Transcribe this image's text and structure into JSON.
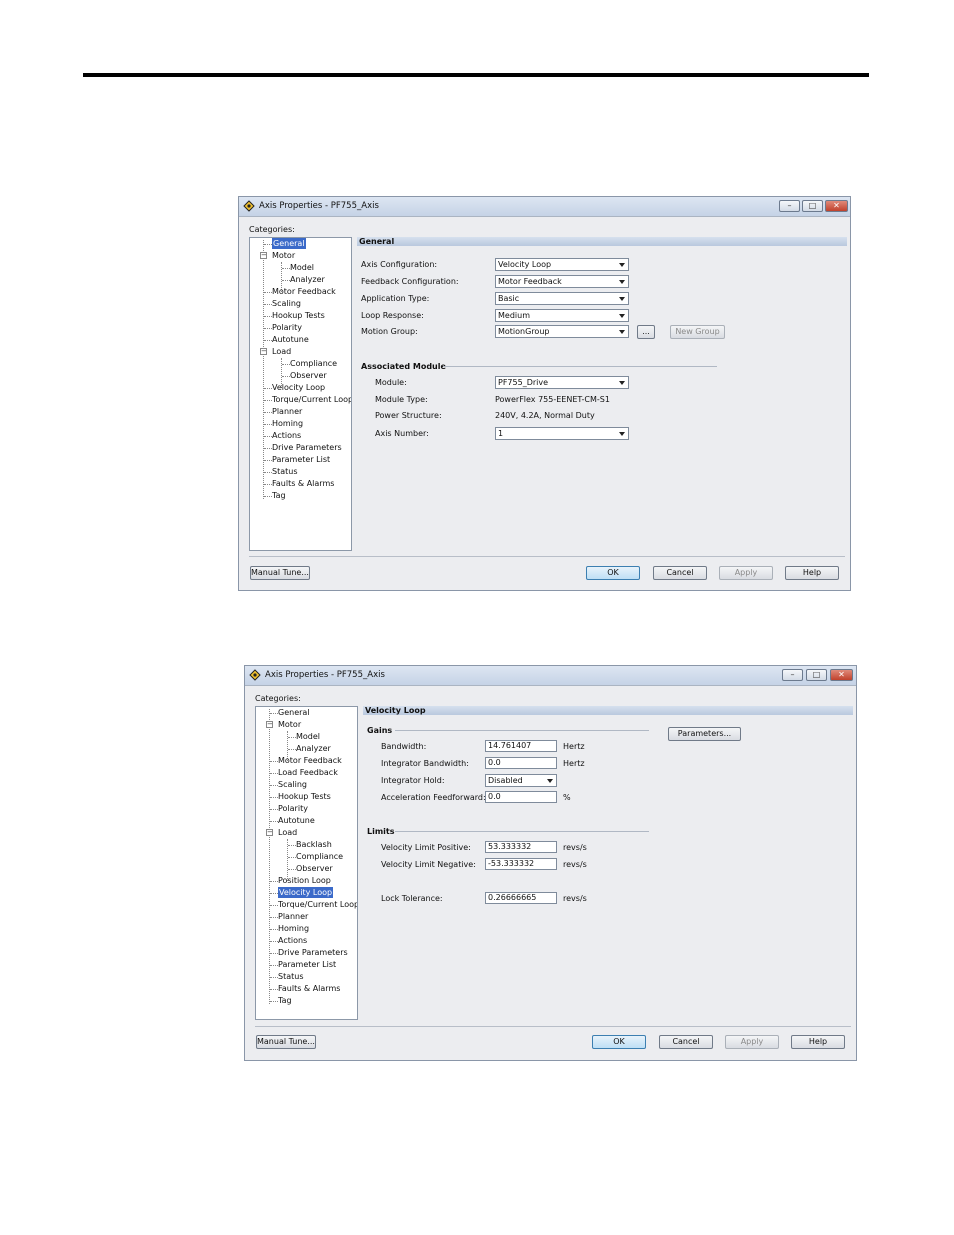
{
  "dialog1": {
    "title": "Axis Properties - PF755_Axis",
    "categories_label": "Categories:",
    "tree": [
      "General",
      "Motor",
      "Model",
      "Analyzer",
      "Motor Feedback",
      "Scaling",
      "Hookup Tests",
      "Polarity",
      "Autotune",
      "Load",
      "Compliance",
      "Observer",
      "Velocity Loop",
      "Torque/Current Loop",
      "Planner",
      "Homing",
      "Actions",
      "Drive Parameters",
      "Parameter List",
      "Status",
      "Faults & Alarms",
      "Tag"
    ],
    "selected": "General",
    "section_title": "General",
    "fields": [
      {
        "label": "Axis Configuration:",
        "value": "Velocity Loop"
      },
      {
        "label": "Feedback Configuration:",
        "value": "Motor Feedback"
      },
      {
        "label": "Application Type:",
        "value": "Basic"
      },
      {
        "label": "Loop Response:",
        "value": "Medium"
      },
      {
        "label": "Motion Group:",
        "value": "MotionGroup"
      }
    ],
    "ellipsis_button": "...",
    "new_group_button": "New Group",
    "associated_module": {
      "title": "Associated Module",
      "module_label": "Module:",
      "module_value": "PF755_Drive",
      "module_type_label": "Module Type:",
      "module_type_value": "PowerFlex 755-EENET-CM-S1",
      "power_structure_label": "Power Structure:",
      "power_structure_value": "240V, 4.2A, Normal Duty",
      "axis_number_label": "Axis Number:",
      "axis_number_value": "1"
    },
    "buttons": {
      "manual_tune": "Manual Tune...",
      "ok": "OK",
      "cancel": "Cancel",
      "apply": "Apply",
      "help": "Help"
    }
  },
  "dialog2": {
    "title": "Axis Properties - PF755_Axis",
    "categories_label": "Categories:",
    "tree": [
      "General",
      "Motor",
      "Model",
      "Analyzer",
      "Motor Feedback",
      "Load Feedback",
      "Scaling",
      "Hookup Tests",
      "Polarity",
      "Autotune",
      "Load",
      "Backlash",
      "Compliance",
      "Observer",
      "Position Loop",
      "Velocity Loop",
      "Torque/Current Loop",
      "Planner",
      "Homing",
      "Actions",
      "Drive Parameters",
      "Parameter List",
      "Status",
      "Faults & Alarms",
      "Tag"
    ],
    "selected": "Velocity Loop",
    "section_title": "Velocity Loop",
    "parameters_button": "Parameters...",
    "gains": {
      "title": "Gains",
      "bandwidth_label": "Bandwidth:",
      "bandwidth_value": "14.761407",
      "bandwidth_unit": "Hertz",
      "integrator_bandwidth_label": "Integrator Bandwidth:",
      "integrator_bandwidth_value": "0.0",
      "integrator_bandwidth_unit": "Hertz",
      "integrator_hold_label": "Integrator Hold:",
      "integrator_hold_value": "Disabled",
      "accel_ff_label": "Acceleration Feedforward:",
      "accel_ff_value": "0.0",
      "accel_ff_unit": "%"
    },
    "limits": {
      "title": "Limits",
      "vel_pos_label": "Velocity Limit Positive:",
      "vel_pos_value": "53.333332",
      "vel_pos_unit": "revs/s",
      "vel_neg_label": "Velocity Limit Negative:",
      "vel_neg_value": "-53.333332",
      "vel_neg_unit": "revs/s",
      "lock_tol_label": "Lock Tolerance:",
      "lock_tol_value": "0.26666665",
      "lock_tol_unit": "revs/s"
    },
    "buttons": {
      "manual_tune": "Manual Tune...",
      "ok": "OK",
      "cancel": "Cancel",
      "apply": "Apply",
      "help": "Help"
    }
  },
  "window_controls": {
    "minimize": "–",
    "maximize": "□",
    "close": "✕"
  }
}
